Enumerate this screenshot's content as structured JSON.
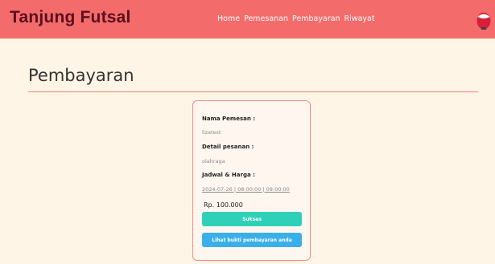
{
  "brand": "Tanjung Futsal",
  "nav": {
    "items": [
      "Home",
      "Pemesanan",
      "Pembayaran",
      "Riwayat"
    ]
  },
  "page": {
    "title": "Pembayaran"
  },
  "card": {
    "name_label": "Nama Pemesan :",
    "name_value": "lizatest",
    "detail_label": "Detail pesanan :",
    "detail_value": "olahraga",
    "schedule_label": "Jadwal & Harga :",
    "schedule_value": "2024-07-26 | 08:00:00 | 09:00:00",
    "price": "Rp. 100.000",
    "success_button": "Sukses",
    "proof_button": "Lihat bukti pembayaran anda"
  },
  "colors": {
    "navbar": "#f46b6b",
    "background": "#fff5e6",
    "success": "#2ed1b8",
    "proof": "#3ab0ea"
  },
  "icons": {
    "avatar": "avatar-icon"
  }
}
